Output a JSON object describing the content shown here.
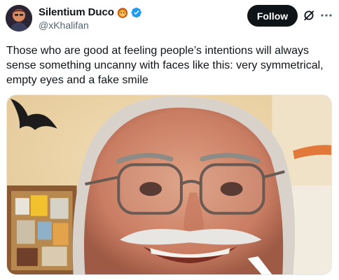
{
  "tweet": {
    "author": {
      "display_name": "Silentium Duco",
      "handle": "@xKhalifan",
      "badge_emoji": "lion-face-emoji",
      "verified": true
    },
    "follow_label": "Follow",
    "icons": {
      "grok": "grok-icon",
      "more": "more-horizontal-icon"
    },
    "text": "Those who are good at feeling people’s intentions will always sense something uncanny with faces like this: very symmetrical, empty eyes and a fake smile",
    "media": {
      "kind": "photo",
      "subject": "smiling-face-photo"
    }
  },
  "colors": {
    "follow_bg": "#0f1419",
    "verified_blue": "#1d9bf0",
    "handle_gray": "#536471"
  }
}
